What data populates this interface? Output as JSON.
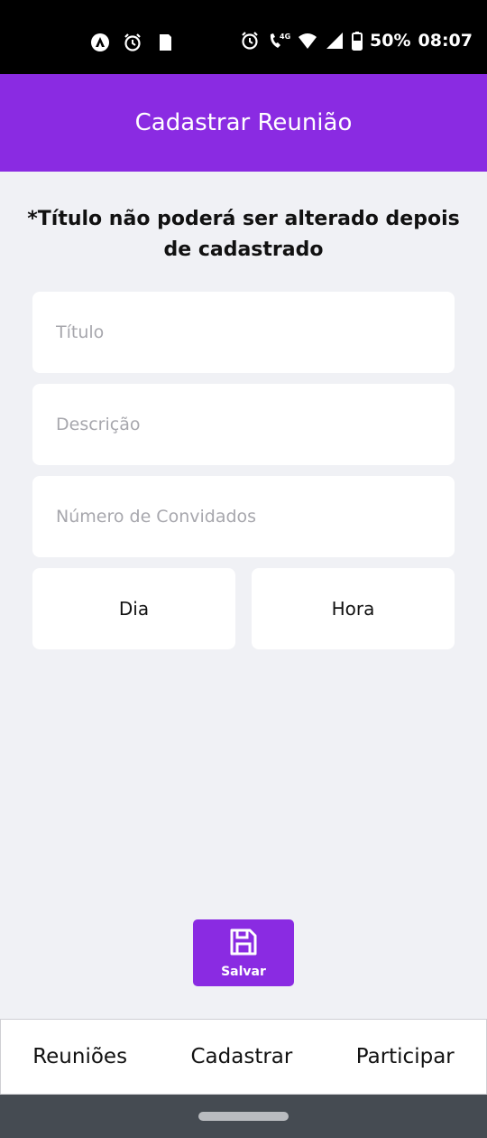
{
  "status_bar": {
    "battery_percent": "50%",
    "time": "08:07",
    "left_icons": [
      "android-auto-icon",
      "alarm-icon",
      "sd-card-icon"
    ],
    "right_icons": [
      "alarm-icon",
      "volte-call-icon",
      "wifi-icon",
      "cell-signal-icon",
      "battery-icon"
    ],
    "network_label": "4G"
  },
  "header": {
    "title": "Cadastrar Reunião",
    "color": "#8a2be2"
  },
  "notice": "*Título não poderá ser alterado depois de cadastrado",
  "form": {
    "title_placeholder": "Título",
    "title_value": "",
    "description_placeholder": "Descrição",
    "description_value": "",
    "guests_placeholder": "Número de Convidados",
    "guests_value": "",
    "day_label": "Dia",
    "hour_label": "Hora"
  },
  "save_button": {
    "label": "Salvar",
    "icon": "floppy-disk-icon"
  },
  "bottom_nav": {
    "items": [
      {
        "label": "Reuniões"
      },
      {
        "label": "Cadastrar"
      },
      {
        "label": "Participar"
      }
    ]
  }
}
